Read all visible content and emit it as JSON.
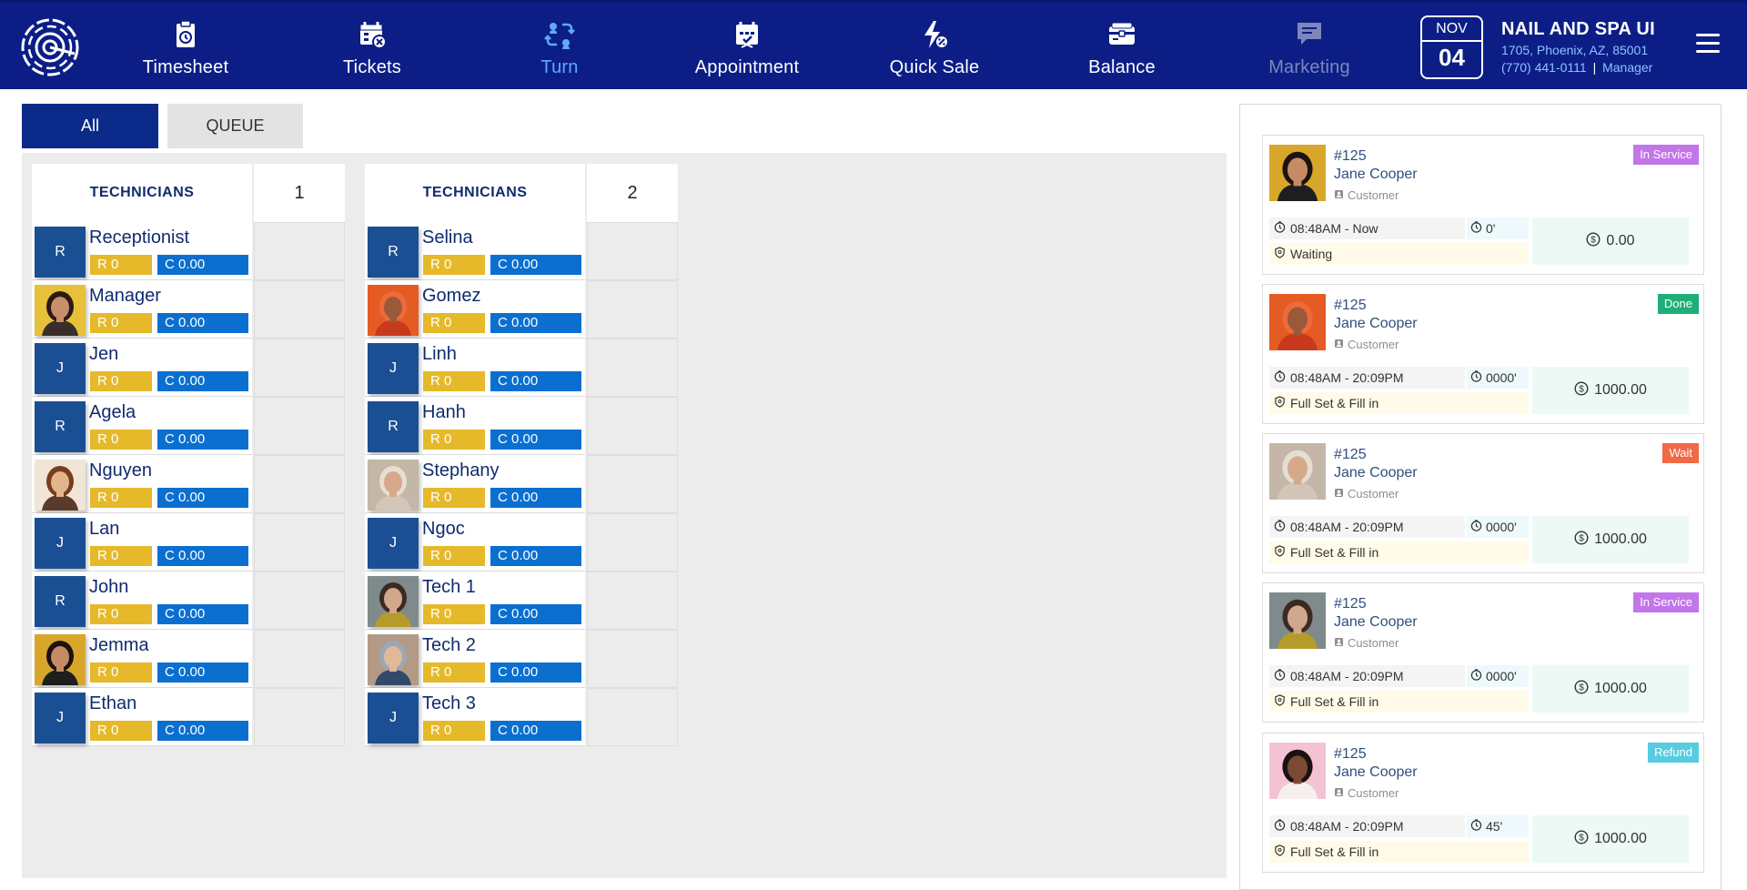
{
  "nav": {
    "items": [
      {
        "label": "Timesheet",
        "icon": "timesheet-icon",
        "state": "normal"
      },
      {
        "label": "Tickets",
        "icon": "tickets-icon",
        "state": "normal"
      },
      {
        "label": "Turn",
        "icon": "turn-icon",
        "state": "active"
      },
      {
        "label": "Appointment",
        "icon": "appointment-icon",
        "state": "normal"
      },
      {
        "label": "Quick Sale",
        "icon": "quick-sale-icon",
        "state": "normal"
      },
      {
        "label": "Balance",
        "icon": "balance-icon",
        "state": "normal"
      },
      {
        "label": "Marketing",
        "icon": "marketing-icon",
        "state": "disabled"
      }
    ]
  },
  "calendar": {
    "month": "NOV",
    "day": "04"
  },
  "store": {
    "name": "NAIL AND SPA UI",
    "address": "1705, Phoenix, AZ, 85001",
    "phone": "(770) 441-0111",
    "separator": "|",
    "role": "Manager"
  },
  "tabs": {
    "all": "All",
    "queue": "QUEUE"
  },
  "columns": [
    {
      "title": "TECHNICIANS",
      "number": "1",
      "techs": [
        {
          "name": "Receptionist",
          "initial": "R",
          "photo": false,
          "r": "R 0",
          "c": "C 0.00"
        },
        {
          "name": "Manager",
          "initial": "",
          "photo": true,
          "r": "R 0",
          "c": "C 0.00"
        },
        {
          "name": "Jen",
          "initial": "J",
          "photo": false,
          "r": "R 0",
          "c": "C 0.00"
        },
        {
          "name": "Agela",
          "initial": "R",
          "photo": false,
          "r": "R 0",
          "c": "C 0.00"
        },
        {
          "name": "Nguyen",
          "initial": "",
          "photo": true,
          "r": "R 0",
          "c": "C 0.00"
        },
        {
          "name": "Lan",
          "initial": "J",
          "photo": false,
          "r": "R 0",
          "c": "C 0.00"
        },
        {
          "name": "John",
          "initial": "R",
          "photo": false,
          "r": "R 0",
          "c": "C 0.00"
        },
        {
          "name": "Jemma",
          "initial": "",
          "photo": true,
          "r": "R 0",
          "c": "C 0.00"
        },
        {
          "name": "Ethan",
          "initial": "J",
          "photo": false,
          "r": "R 0",
          "c": "C 0.00"
        }
      ]
    },
    {
      "title": "TECHNICIANS",
      "number": "2",
      "techs": [
        {
          "name": "Selina",
          "initial": "R",
          "photo": false,
          "r": "R 0",
          "c": "C 0.00"
        },
        {
          "name": "Gomez",
          "initial": "",
          "photo": true,
          "r": "R 0",
          "c": "C 0.00"
        },
        {
          "name": "Linh",
          "initial": "J",
          "photo": false,
          "r": "R 0",
          "c": "C 0.00"
        },
        {
          "name": "Hanh",
          "initial": "R",
          "photo": false,
          "r": "R 0",
          "c": "C 0.00"
        },
        {
          "name": "Stephany",
          "initial": "",
          "photo": true,
          "r": "R 0",
          "c": "C 0.00"
        },
        {
          "name": "Ngoc",
          "initial": "J",
          "photo": false,
          "r": "R 0",
          "c": "C 0.00"
        },
        {
          "name": "Tech 1",
          "initial": "",
          "photo": true,
          "r": "R 0",
          "c": "C 0.00"
        },
        {
          "name": "Tech 2",
          "initial": "",
          "photo": true,
          "r": "R 0",
          "c": "C 0.00"
        },
        {
          "name": "Tech 3",
          "initial": "J",
          "photo": false,
          "r": "R 0",
          "c": "C 0.00"
        }
      ]
    }
  ],
  "tickets": [
    {
      "number": "#125",
      "customer": "Jane Cooper",
      "role": "Customer",
      "status": "In Service",
      "status_color": "#c375ea",
      "time": "08:48AM - Now",
      "duration": "0'",
      "service": "Waiting",
      "amount": "0.00"
    },
    {
      "number": "#125",
      "customer": "Jane Cooper",
      "role": "Customer",
      "status": "Done",
      "status_color": "#1fae78",
      "time": "08:48AM - 20:09PM",
      "duration": "0000'",
      "service": "Full Set & Fill in",
      "amount": "1000.00"
    },
    {
      "number": "#125",
      "customer": "Jane Cooper",
      "role": "Customer",
      "status": "Wait",
      "status_color": "#ef6a45",
      "time": "08:48AM - 20:09PM",
      "duration": "0000'",
      "service": "Full Set & Fill in",
      "amount": "1000.00"
    },
    {
      "number": "#125",
      "customer": "Jane Cooper",
      "role": "Customer",
      "status": "In Service",
      "status_color": "#c375ea",
      "time": "08:48AM - 20:09PM",
      "duration": "0000'",
      "service": "Full Set & Fill in",
      "amount": "1000.00"
    },
    {
      "number": "#125",
      "customer": "Jane Cooper",
      "role": "Customer",
      "status": "Refund",
      "status_color": "#57cbe0",
      "time": "08:48AM - 20:09PM",
      "duration": "45'",
      "service": "Full Set & Fill in",
      "amount": "1000.00"
    }
  ],
  "colors": {
    "topbar": "#0c1e86",
    "active_nav": "#61a9ff",
    "r_chip": "#e5b92a",
    "c_chip": "#0b6fd0",
    "avatar": "#1b4f93"
  }
}
